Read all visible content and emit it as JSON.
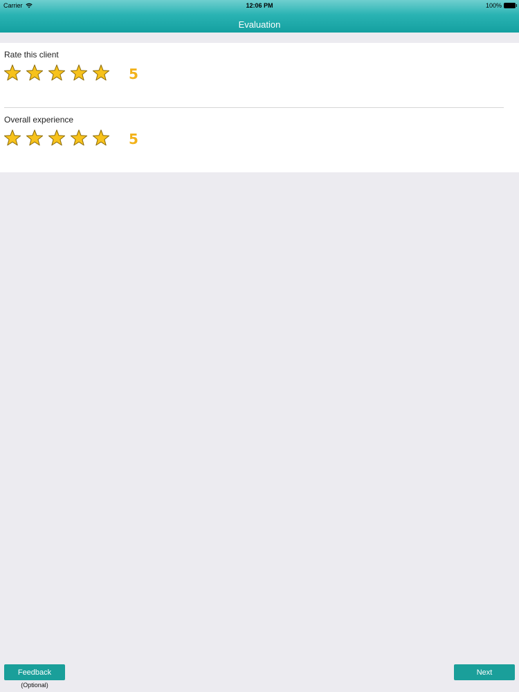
{
  "status_bar": {
    "carrier": "Carrier",
    "time": "12:06 PM",
    "battery": "100%",
    "icons": [
      "wifi-icon",
      "battery-icon"
    ]
  },
  "nav": {
    "title": "Evaluation"
  },
  "ratings": [
    {
      "label": "Rate this client",
      "value": "5",
      "stars_filled": 5,
      "stars_total": 5
    },
    {
      "label": "Overall experience",
      "value": "5",
      "stars_filled": 5,
      "stars_total": 5
    }
  ],
  "footer": {
    "feedback_label": "Feedback",
    "feedback_note": "(Optional)",
    "next_label": "Next"
  },
  "colors": {
    "accent": "#1a9f9a",
    "star_fill": "#f7c21c",
    "star_stroke": "#8a6a0a",
    "rating_value": "#f2b21b",
    "background": "#ecebf0"
  }
}
